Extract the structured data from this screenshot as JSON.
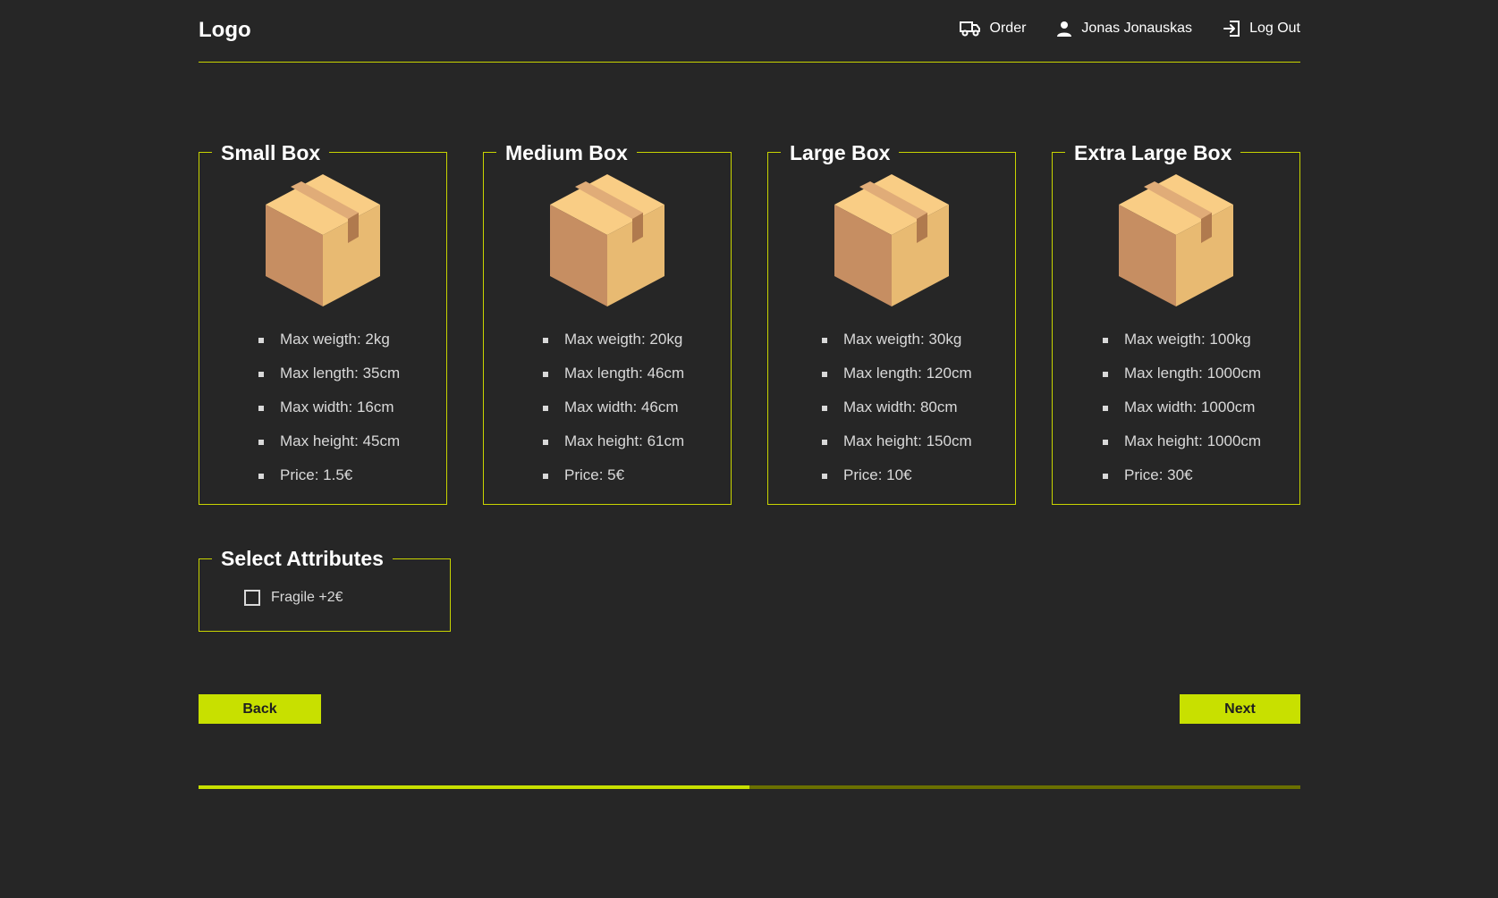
{
  "header": {
    "logo": "Logo",
    "nav": {
      "order": "Order",
      "user": "Jonas Jonauskas",
      "logout": "Log Out"
    }
  },
  "boxes": [
    {
      "title": "Small Box",
      "specs": [
        "Max weigth: 2kg",
        "Max length: 35cm",
        "Max width: 16cm",
        "Max height: 45cm",
        "Price: 1.5€"
      ]
    },
    {
      "title": "Medium Box",
      "specs": [
        "Max weigth: 20kg",
        "Max length: 46cm",
        "Max width: 46cm",
        "Max height: 61cm",
        "Price: 5€"
      ]
    },
    {
      "title": "Large Box",
      "specs": [
        "Max weigth: 30kg",
        "Max length: 120cm",
        "Max width: 80cm",
        "Max height: 150cm",
        "Price: 10€"
      ]
    },
    {
      "title": "Extra Large Box",
      "specs": [
        "Max weigth: 100kg",
        "Max length: 1000cm",
        "Max width: 1000cm",
        "Max height: 1000cm",
        "Price: 30€"
      ]
    }
  ],
  "attributes": {
    "title": "Select Attributes",
    "options": [
      {
        "label": "Fragile +2€",
        "checked": false
      }
    ]
  },
  "buttons": {
    "back": "Back",
    "next": "Next"
  },
  "progress": {
    "fraction": 0.5
  },
  "colors": {
    "accent": "#c8e000",
    "border": "#c8d400",
    "background": "#262626",
    "track": "#6a7000"
  },
  "icons": {
    "order": "truck-icon",
    "user": "user-icon",
    "logout": "logout-icon",
    "box": "cardboard-box-icon",
    "checkbox": "checkbox-icon"
  }
}
